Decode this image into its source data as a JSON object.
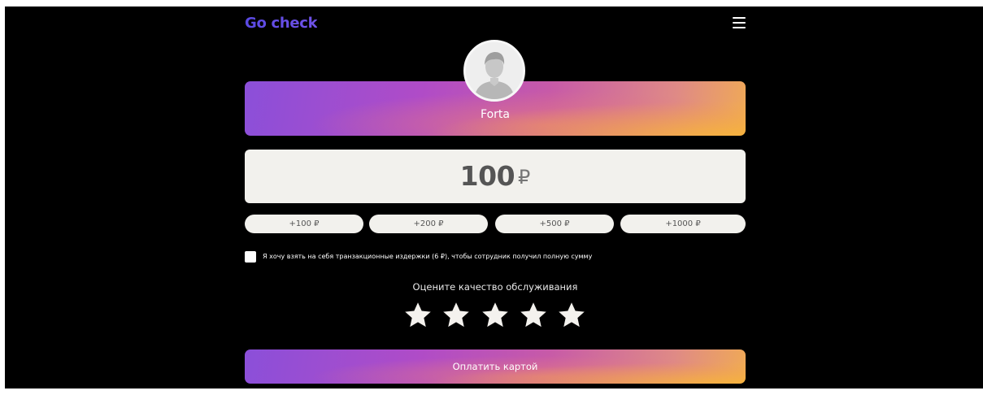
{
  "header": {
    "logo": "Go check",
    "menu_icon": "hamburger-menu-icon"
  },
  "profile": {
    "name": "Forta",
    "avatar_icon": "user-avatar-placeholder-icon"
  },
  "amount": {
    "value": "100",
    "currency": "₽"
  },
  "quick_amounts": [
    {
      "label": "+100 ₽"
    },
    {
      "label": "+200 ₽"
    },
    {
      "label": "+500 ₽"
    },
    {
      "label": "+1000 ₽"
    }
  ],
  "fee_checkbox": {
    "checked": true,
    "label": "Я хочу взять на себя транзакционные издержки (6 ₽), чтобы сотрудник получил полную сумму"
  },
  "rating": {
    "title": "Оцените качество обслуживания",
    "max": 5,
    "value": 0,
    "star_icon": "star-icon"
  },
  "pay_button": {
    "label": "Оплатить картой"
  },
  "colors": {
    "background": "#000000",
    "logo": "#5b4de6",
    "gradient_start": "#8b4fd9",
    "gradient_end": "#f0aa55",
    "field_background": "#f2f1ed"
  }
}
